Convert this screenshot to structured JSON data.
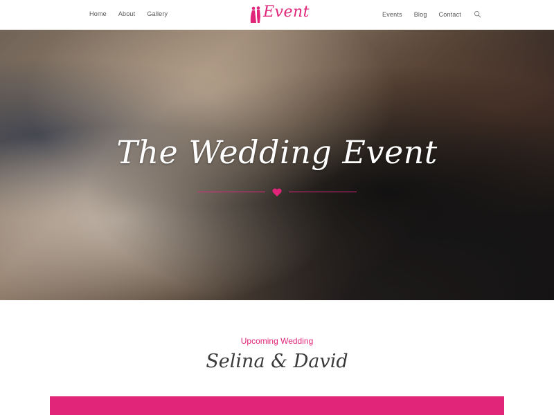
{
  "nav": {
    "left_items": [
      {
        "label": "Home"
      },
      {
        "label": "About"
      },
      {
        "label": "Gallery"
      }
    ],
    "right_items": [
      {
        "label": "Events"
      },
      {
        "label": "Blog"
      },
      {
        "label": "Contact"
      }
    ],
    "logo_text": "Event",
    "search_icon": "search-icon"
  },
  "hero": {
    "title": "The Wedding Event",
    "divider_icon": "heart-icon"
  },
  "section": {
    "subtitle": "Upcoming Wedding",
    "names": "Selina & David"
  },
  "colors": {
    "accent": "#e1267a",
    "text": "#555555"
  }
}
